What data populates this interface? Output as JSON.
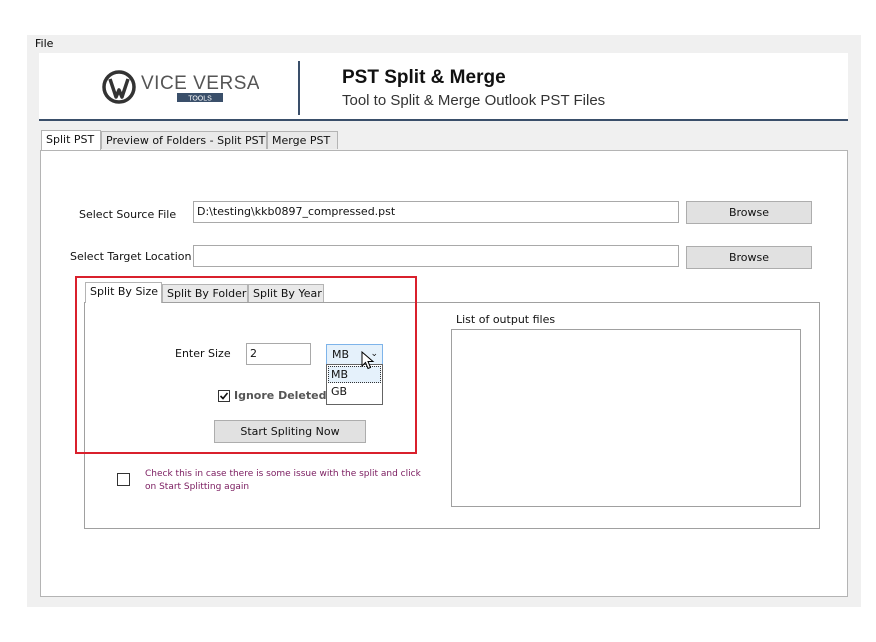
{
  "menu": {
    "file": "File"
  },
  "header": {
    "logo_text": "VICE VERSA",
    "logo_sub": "TOOLS",
    "title": "PST Split & Merge",
    "subtitle": "Tool to Split & Merge Outlook PST Files"
  },
  "tabs": [
    {
      "label": "Split PST",
      "active": true
    },
    {
      "label": "Preview of Folders - Split PST",
      "active": false
    },
    {
      "label": "Merge  PST",
      "active": false
    }
  ],
  "source": {
    "label": "Select Source File",
    "value": "D:\\testing\\kkb0897_compressed.pst",
    "browse": "Browse"
  },
  "target": {
    "label": "Select Target Location",
    "value": "",
    "browse": "Browse"
  },
  "subtabs": [
    {
      "label": "Split By Size",
      "active": true
    },
    {
      "label": "Split By Folder",
      "active": false
    },
    {
      "label": "Split By Year",
      "active": false
    }
  ],
  "split_size": {
    "label": "Enter Size",
    "value": "2",
    "unit_selected": "MB",
    "unit_options": [
      "MB",
      "GB"
    ],
    "ignore_deleted_label": "Ignore Deleted F",
    "ignore_deleted_checked": true,
    "start_button": "Start Spliting Now"
  },
  "retry_note": {
    "text": "Check this in case there is some issue with the split and click on Start Splitting again",
    "checked": false
  },
  "output": {
    "label": "List of output files"
  },
  "colors": {
    "highlight_box": "#d9202c",
    "header_rule": "#3a4f6a",
    "note_text": "#7a1b5f"
  }
}
